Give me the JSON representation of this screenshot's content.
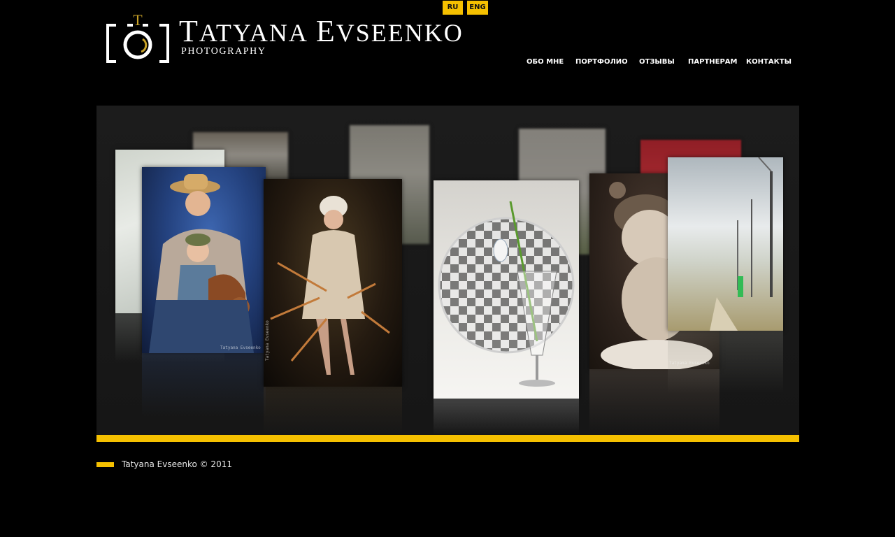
{
  "lang": {
    "ru": "RU",
    "en": "ENG"
  },
  "logo": {
    "title_first": "Tatyana",
    "title_last": "Evseenko",
    "subtitle": "PHOTOGRAPHY",
    "mark_letter": "T"
  },
  "nav": {
    "items": [
      {
        "label": "ОБО МНЕ"
      },
      {
        "label": "ПОРТФОЛИО"
      },
      {
        "label": "ОТЗЫВЫ"
      },
      {
        "label": "ПАРТНЕРАМ"
      },
      {
        "label": "КОНТАКТЫ"
      }
    ]
  },
  "gallery": {
    "watermark": "Tatyana Evseenko",
    "photos": [
      {
        "subject": "man-with-child-on-toy-horse"
      },
      {
        "subject": "woman-in-fur-coat"
      },
      {
        "subject": "glass-with-snowdrop-and-sphere"
      },
      {
        "subject": "smiling-baby"
      },
      {
        "subject": "couple-among-windmills"
      }
    ]
  },
  "footer": {
    "copyright": "Tatyana Evseenko © 2011"
  },
  "colors": {
    "accent": "#f5c000",
    "background": "#000000",
    "stage": "#1a1a1a"
  }
}
